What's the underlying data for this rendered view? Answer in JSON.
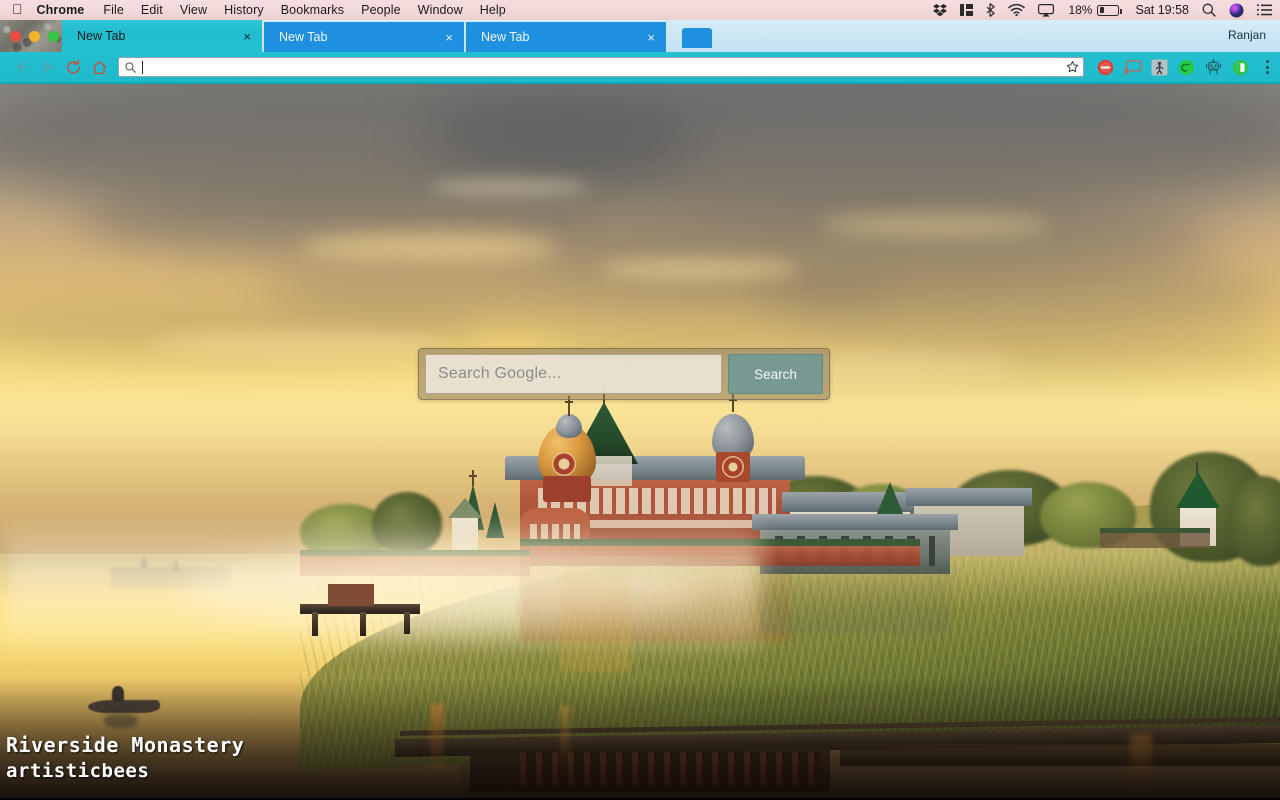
{
  "menubar": {
    "apple_icon": "apple-logo-icon",
    "items": [
      {
        "label": "Chrome",
        "bold": true
      },
      {
        "label": "File",
        "bold": false
      },
      {
        "label": "Edit",
        "bold": false
      },
      {
        "label": "View",
        "bold": false
      },
      {
        "label": "History",
        "bold": false
      },
      {
        "label": "Bookmarks",
        "bold": false
      },
      {
        "label": "People",
        "bold": false
      },
      {
        "label": "Window",
        "bold": false
      },
      {
        "label": "Help",
        "bold": false
      }
    ],
    "status_icons": [
      "dropbox-icon",
      "columns-icon",
      "bluetooth-icon",
      "wifi-icon",
      "airplay-icon"
    ],
    "battery_percent": "18%",
    "clock": "Sat 19:58",
    "right_icons": [
      "spotlight-search-icon",
      "siri-icon",
      "notification-center-icon"
    ]
  },
  "window": {
    "traffic_lights": [
      "close-button",
      "minimize-button",
      "zoom-button"
    ],
    "profile_name": "Ranjan",
    "tabs": [
      {
        "title": "New Tab",
        "active": true,
        "close": "×"
      },
      {
        "title": "New Tab",
        "active": false,
        "close": "×"
      },
      {
        "title": "New Tab",
        "active": false,
        "close": "×"
      }
    ],
    "new_tab_button": "new-tab-button"
  },
  "toolbar": {
    "back": "back-arrow-icon",
    "forward": "forward-arrow-icon",
    "reload": "reload-icon",
    "home": "home-icon",
    "omnibox": {
      "value": "",
      "placeholder": "",
      "leading_icon": "search-icon",
      "bookmark_icon": "star-icon"
    },
    "extensions": [
      "adblock-icon",
      "cast-icon",
      "figure-extension-icon",
      "green-circle-extension-icon",
      "robot-extension-icon",
      "green-tab-extension-icon"
    ],
    "menu": "kebab-menu-icon"
  },
  "newtab": {
    "search": {
      "placeholder": "Search Google...",
      "button_label": "Search"
    },
    "photo": {
      "title": "Riverside Monastery",
      "author": "artisticbees"
    }
  },
  "colors": {
    "tab_active": "#21bccd",
    "tab_inactive": "#1f8fe0",
    "toolbar": "#23c0d1",
    "menubar": "#f2d8d8",
    "search_button": "#6c9898",
    "search_field": "#ece5d6"
  }
}
